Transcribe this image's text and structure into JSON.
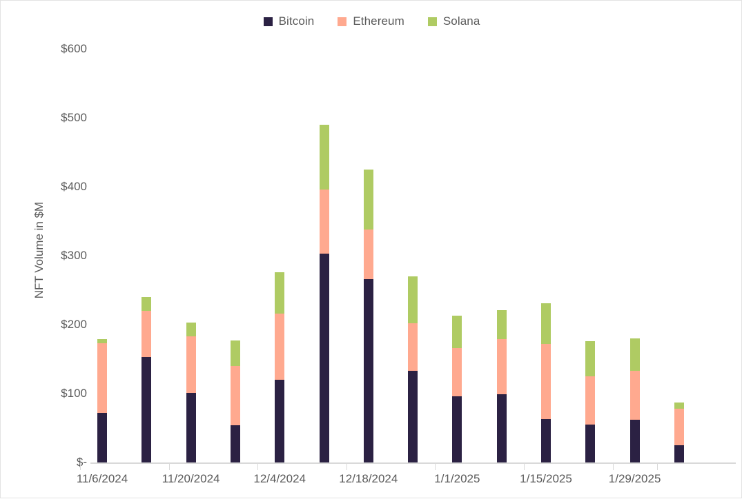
{
  "chart_data": {
    "type": "bar",
    "subtype": "stacked-bar",
    "title": "",
    "xlabel": "",
    "ylabel": "NFT Volume in $M",
    "ylim": [
      0,
      600
    ],
    "ytick_values": [
      0,
      100,
      200,
      300,
      400,
      500,
      600
    ],
    "ytick_labels": [
      "$-",
      "$100",
      "$200",
      "$300",
      "$400",
      "$500",
      "$600"
    ],
    "grid": false,
    "legend_position": "top-center",
    "x": [
      "11/6/2024",
      "11/13/2024",
      "11/20/2024",
      "11/27/2024",
      "12/4/2024",
      "12/11/2024",
      "12/18/2024",
      "12/25/2024",
      "1/1/2025",
      "1/8/2025",
      "1/15/2025",
      "1/22/2025",
      "1/29/2025",
      "2/5/2025"
    ],
    "xtick_labels": [
      "11/6/2024",
      "11/20/2024",
      "12/4/2024",
      "12/18/2024",
      "1/1/2025",
      "1/15/2025",
      "1/29/2025"
    ],
    "xtick_indices": [
      0,
      2,
      4,
      6,
      8,
      10,
      12
    ],
    "series": [
      {
        "name": "Bitcoin",
        "color": "#2B2143",
        "values": [
          72,
          153,
          101,
          54,
          120,
          303,
          266,
          133,
          96,
          99,
          63,
          55,
          62,
          25
        ]
      },
      {
        "name": "Ethereum",
        "color": "#FFA98F",
        "values": [
          101,
          67,
          82,
          86,
          96,
          93,
          72,
          69,
          70,
          80,
          109,
          70,
          71,
          53
        ]
      },
      {
        "name": "Solana",
        "color": "#AFCB63",
        "values": [
          6,
          20,
          20,
          37,
          60,
          94,
          87,
          68,
          47,
          42,
          59,
          51,
          47,
          9
        ]
      }
    ],
    "totals": [
      179,
      240,
      203,
      177,
      276,
      490,
      425,
      270,
      213,
      221,
      231,
      176,
      180,
      87
    ]
  },
  "legend": {
    "items": [
      {
        "label": "Bitcoin",
        "color": "#2B2143",
        "swatch": "square-swatch"
      },
      {
        "label": "Ethereum",
        "color": "#FFA98F",
        "swatch": "square-swatch"
      },
      {
        "label": "Solana",
        "color": "#AFCB63",
        "swatch": "square-swatch"
      }
    ]
  },
  "axes": {
    "y_title": "NFT Volume in $M",
    "axis_color": "#d9d9d9",
    "text_color": "#5a5a5a"
  }
}
